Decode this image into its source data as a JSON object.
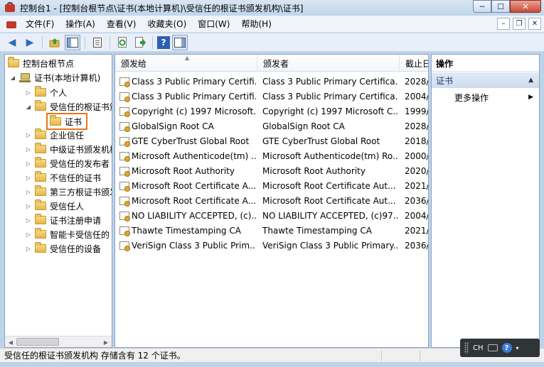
{
  "window": {
    "title": "控制台1 - [控制台根节点\\证书(本地计算机)\\受信任的根证书颁发机构\\证书]",
    "min_glyph": "─",
    "max_glyph": "☐",
    "close_glyph": "✕"
  },
  "menu": {
    "items": [
      "文件(F)",
      "操作(A)",
      "查看(V)",
      "收藏夹(O)",
      "窗口(W)",
      "帮助(H)"
    ],
    "mdi": [
      "–",
      "❐",
      "✕"
    ]
  },
  "toolbar": {
    "back": "◀",
    "forward": "▶",
    "help": "?"
  },
  "tree": {
    "root": "控制台根节点",
    "computer": "证书(本地计算机)",
    "items": [
      {
        "label": "个人",
        "expanded": false
      },
      {
        "label": "受信任的根证书颁发",
        "expanded": true
      },
      {
        "label": "企业信任",
        "expanded": false
      },
      {
        "label": "中级证书颁发机构",
        "expanded": false
      },
      {
        "label": "受信任的发布者",
        "expanded": false
      },
      {
        "label": "不信任的证书",
        "expanded": false
      },
      {
        "label": "第三方根证书颁发",
        "expanded": false
      },
      {
        "label": "受信任人",
        "expanded": false
      },
      {
        "label": "证书注册申请",
        "expanded": false
      },
      {
        "label": "智能卡受信任的",
        "expanded": false
      },
      {
        "label": "受信任的设备",
        "expanded": false
      }
    ],
    "selected": "证书"
  },
  "list": {
    "columns": [
      "颁发给",
      "颁发者",
      "截止日"
    ],
    "rows": [
      [
        "Class 3 Public Primary Certifi...",
        "Class 3 Public Primary Certifica...",
        "2028/"
      ],
      [
        "Class 3 Public Primary Certifi...",
        "Class 3 Public Primary Certifica...",
        "2004/"
      ],
      [
        "Copyright (c) 1997 Microsoft...",
        "Copyright (c) 1997 Microsoft C...",
        "1999/"
      ],
      [
        "GlobalSign Root CA",
        "GlobalSign Root CA",
        "2028/"
      ],
      [
        "GTE CyberTrust Global Root",
        "GTE CyberTrust Global Root",
        "2018/"
      ],
      [
        "Microsoft Authenticode(tm) ...",
        "Microsoft Authenticode(tm) Ro...",
        "2000/"
      ],
      [
        "Microsoft Root Authority",
        "Microsoft Root Authority",
        "2020/"
      ],
      [
        "Microsoft Root Certificate A...",
        "Microsoft Root Certificate Aut...",
        "2021/"
      ],
      [
        "Microsoft Root Certificate A...",
        "Microsoft Root Certificate Aut...",
        "2036/"
      ],
      [
        "NO LIABILITY ACCEPTED, (c)...",
        "NO LIABILITY ACCEPTED, (c)97...",
        "2004/"
      ],
      [
        "Thawte Timestamping CA",
        "Thawte Timestamping CA",
        "2021/"
      ],
      [
        "VeriSign Class 3 Public Prim...",
        "VeriSign Class 3 Public Primary...",
        "2036/"
      ]
    ]
  },
  "actions": {
    "title": "操作",
    "section": "证书",
    "more": "更多操作"
  },
  "status": {
    "text": "受信任的根证书颁发机构 存储含有 12 个证书。"
  },
  "langbar": {
    "lang": "CH",
    "help": "?"
  }
}
